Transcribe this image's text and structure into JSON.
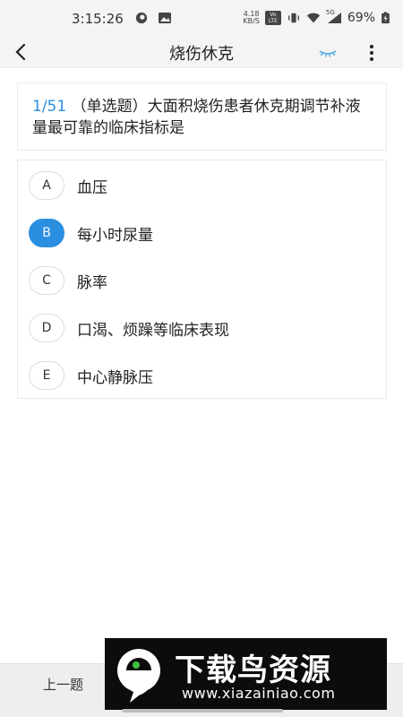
{
  "status_bar": {
    "time": "3:15:26",
    "net_speed_value": "4.18",
    "net_speed_unit": "KB/S",
    "volte_label": "Vo LTE",
    "signal_label": "5G",
    "battery": "69%"
  },
  "header": {
    "title": "烧伤休克"
  },
  "question": {
    "number": "1/51",
    "text": "（单选题）大面积烧伤患者休克期调节补液量最可靠的临床指标是"
  },
  "options": [
    {
      "letter": "A",
      "text": "血压",
      "selected": false
    },
    {
      "letter": "B",
      "text": "每小时尿量",
      "selected": true
    },
    {
      "letter": "C",
      "text": "脉率",
      "selected": false
    },
    {
      "letter": "D",
      "text": "口渴、烦躁等临床表现",
      "selected": false
    },
    {
      "letter": "E",
      "text": "中心静脉压",
      "selected": false
    }
  ],
  "footer": {
    "prev_label": "上一题"
  },
  "watermark": {
    "title": "下载鸟资源",
    "url": "www.xiazainiao.com"
  },
  "colors": {
    "accent": "#2a8fe0",
    "eye_icon": "#4aa8e8"
  }
}
